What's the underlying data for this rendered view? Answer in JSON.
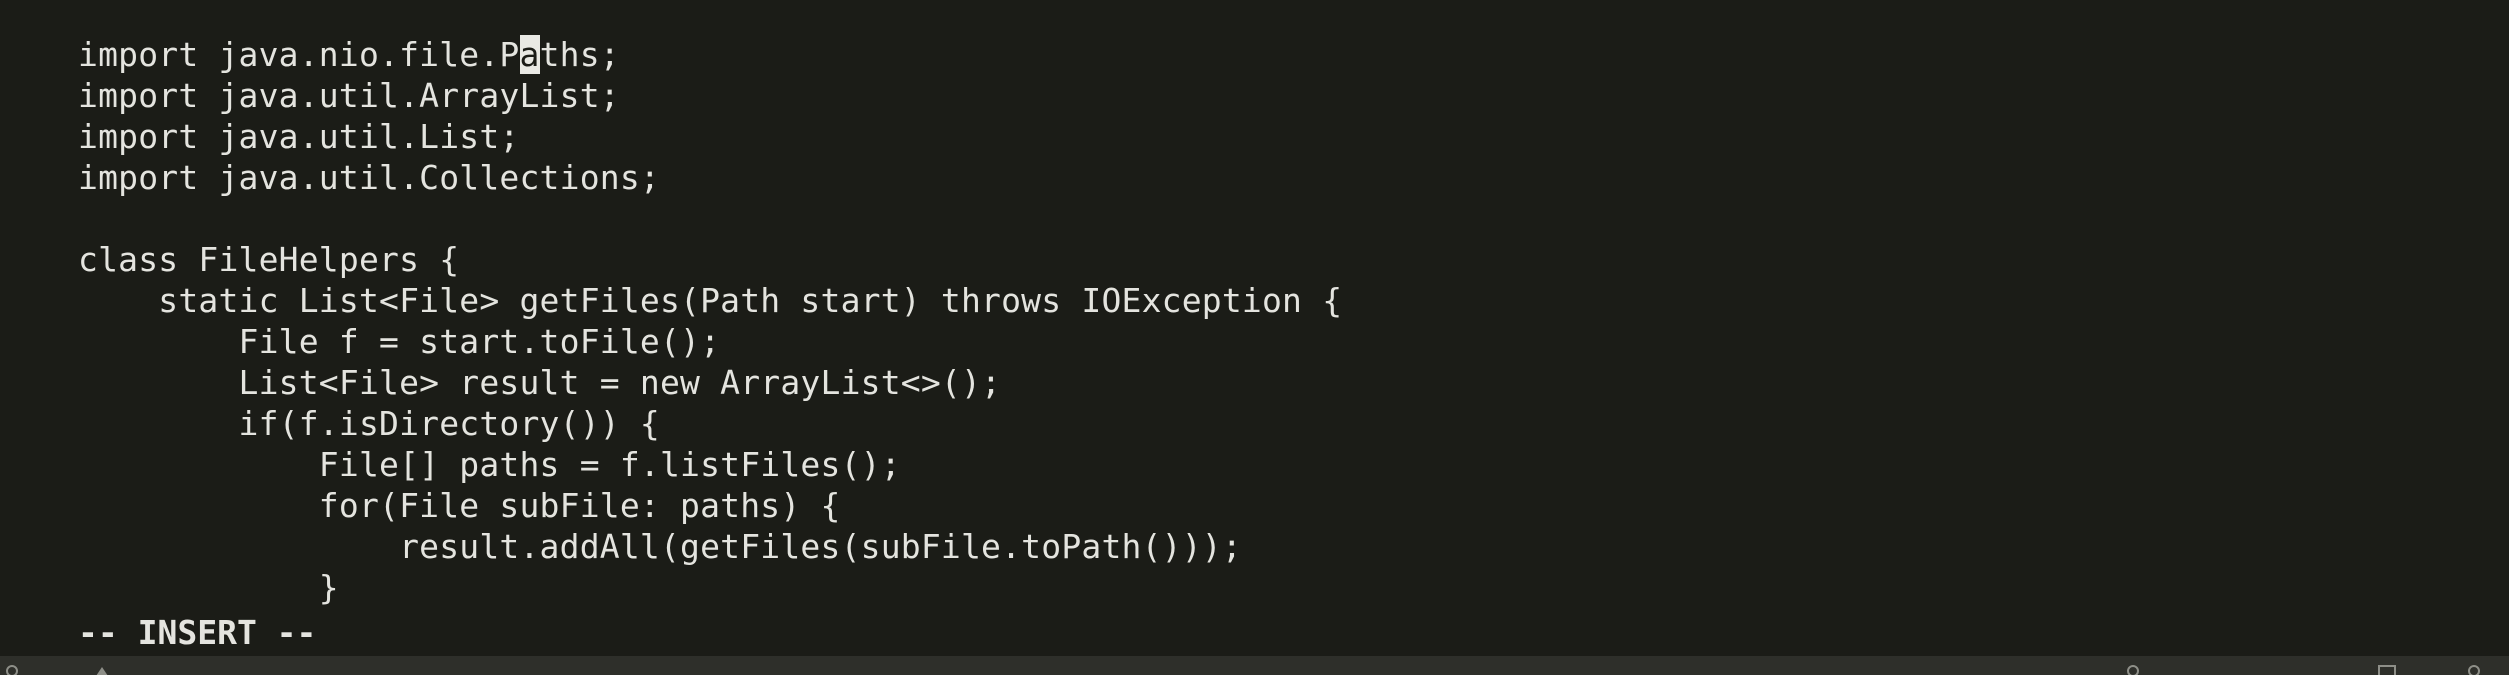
{
  "editor": {
    "lines": [
      {
        "before": "import java.nio.file.P",
        "cursor": "a",
        "after": "ths;"
      },
      {
        "before": "import java.util.ArrayList;",
        "cursor": "",
        "after": ""
      },
      {
        "before": "import java.util.List;",
        "cursor": "",
        "after": ""
      },
      {
        "before": "import java.util.Collections;",
        "cursor": "",
        "after": ""
      },
      {
        "before": "",
        "cursor": "",
        "after": ""
      },
      {
        "before": "class FileHelpers {",
        "cursor": "",
        "after": ""
      },
      {
        "before": "    static List<File> getFiles(Path start) throws IOException {",
        "cursor": "",
        "after": ""
      },
      {
        "before": "        File f = start.toFile();",
        "cursor": "",
        "after": ""
      },
      {
        "before": "        List<File> result = new ArrayList<>();",
        "cursor": "",
        "after": ""
      },
      {
        "before": "        if(f.isDirectory()) {",
        "cursor": "",
        "after": ""
      },
      {
        "before": "            File[] paths = f.listFiles();",
        "cursor": "",
        "after": ""
      },
      {
        "before": "            for(File subFile: paths) {",
        "cursor": "",
        "after": ""
      },
      {
        "before": "                result.addAll(getFiles(subFile.toPath()));",
        "cursor": "",
        "after": ""
      },
      {
        "before": "            }",
        "cursor": "",
        "after": ""
      }
    ]
  },
  "mode": "-- INSERT --",
  "statusbar": {
    "icons": [
      "status-circle-icon",
      "status-triangle-icon",
      "status-circle-icon",
      "status-window-icon",
      "status-circle-icon"
    ]
  },
  "colors": {
    "background": "#1b1c17",
    "text": "#e4e4df",
    "cursor": "#e9e9e4",
    "statusbar": "#2e2f2a"
  }
}
